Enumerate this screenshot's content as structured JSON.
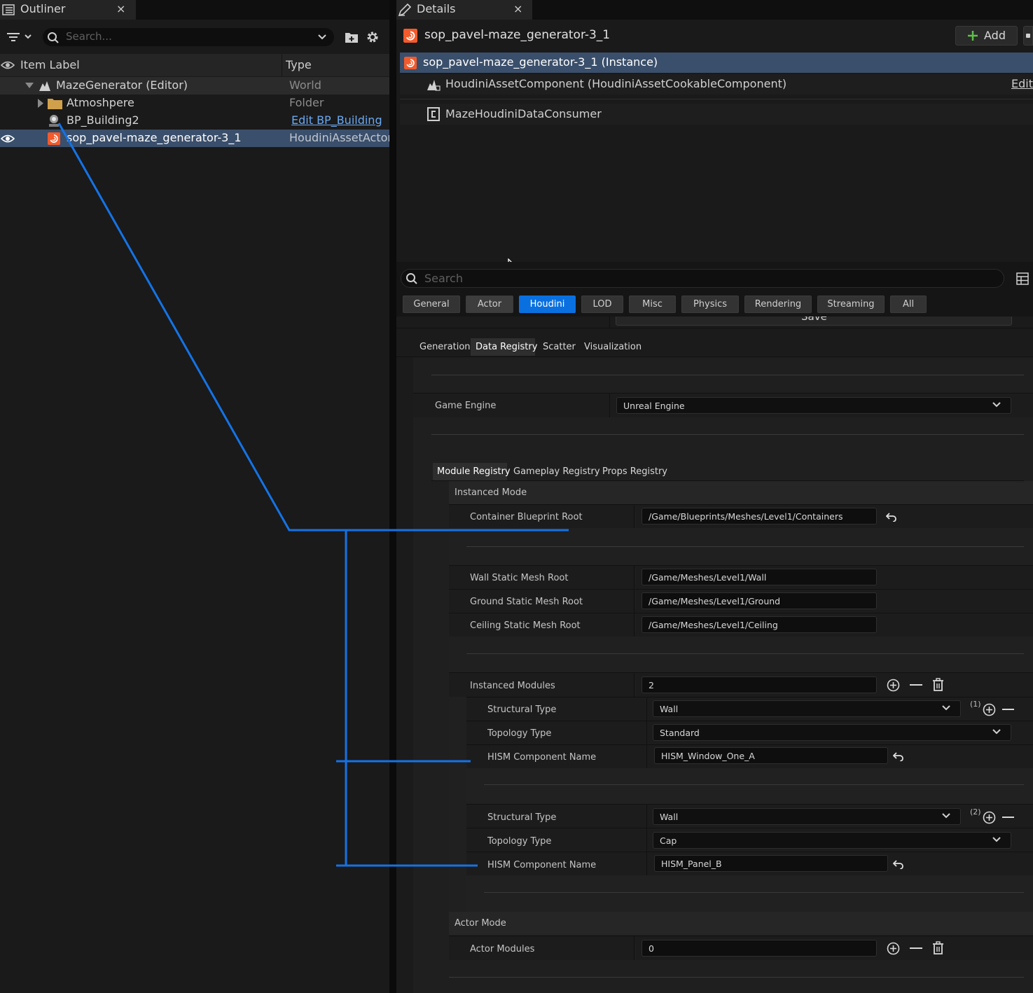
{
  "outliner": {
    "tab_label": "Outliner",
    "close_glyph": "×",
    "search_placeholder": "Search...",
    "columns": {
      "label": "Item Label",
      "type": "Type"
    },
    "rows": [
      {
        "label": "MazeGenerator (Editor)",
        "type": "World"
      },
      {
        "label": "Atmoshpere",
        "type": "Folder"
      },
      {
        "label": "BP_Building2",
        "type": "Edit BP_Building"
      },
      {
        "label": "sop_pavel-maze_generator-3_1",
        "type": "HoudiniAssetActor"
      }
    ]
  },
  "details": {
    "tab_label": "Details",
    "close_glyph": "×",
    "actor_name": "sop_pavel-maze_generator-3_1",
    "add_label": "Add",
    "components": [
      {
        "label": "sop_pavel-maze_generator-3_1 (Instance)"
      },
      {
        "label": "HoudiniAssetComponent (HoudiniAssetCookableComponent)",
        "action": "Edit"
      },
      {
        "label": "MazeHoudiniDataConsumer"
      }
    ],
    "search_placeholder": "Search",
    "filters": [
      "General",
      "Actor",
      "Houdini",
      "LOD",
      "Misc",
      "Physics",
      "Rendering",
      "Streaming",
      "All"
    ],
    "save_label": "Save",
    "subtabs": [
      "Generation",
      "Data Registry",
      "Scatter",
      "Visualization"
    ],
    "game_engine": {
      "label": "Game Engine",
      "value": "Unreal Engine"
    },
    "registry_tabs": [
      "Module Registry",
      "Gameplay Registry",
      "Props Registry"
    ],
    "instanced_mode": {
      "title": "Instanced Mode",
      "container_root": {
        "label": "Container Blueprint Root",
        "value": "/Game/Blueprints/Meshes/Level1/Containers"
      },
      "wall_root": {
        "label": "Wall Static Mesh Root",
        "value": "/Game/Meshes/Level1/Wall"
      },
      "ground_root": {
        "label": "Ground Static Mesh Root",
        "value": "/Game/Meshes/Level1/Ground"
      },
      "ceiling_root": {
        "label": "Ceiling Static Mesh Root",
        "value": "/Game/Meshes/Level1/Ceiling"
      },
      "modules": {
        "label": "Instanced Modules",
        "value": "2"
      },
      "items": [
        {
          "index": "(1)",
          "structural_label": "Structural Type",
          "structural": "Wall",
          "topology_label": "Topology Type",
          "topology": "Standard",
          "hism_label": "HISM Component Name",
          "hism": "HISM_Window_One_A"
        },
        {
          "index": "(2)",
          "structural_label": "Structural Type",
          "structural": "Wall",
          "topology_label": "Topology Type",
          "topology": "Cap",
          "hism_label": "HISM Component Name",
          "hism": "HISM_Panel_B"
        }
      ]
    },
    "actor_mode": {
      "title": "Actor Mode",
      "modules": {
        "label": "Actor Modules",
        "value": "0"
      }
    }
  },
  "colors": {
    "accent": "#0a70e0",
    "annotation_line": "#1473e6",
    "houdini": "#f25a2c",
    "selection": "#3a4f6b"
  }
}
